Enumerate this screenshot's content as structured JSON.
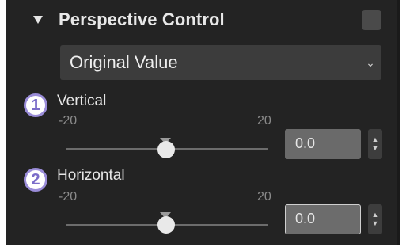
{
  "section": {
    "title": "Perspective Control",
    "dropdown_value": "Original Value"
  },
  "sliders": [
    {
      "badge": "1",
      "label": "Vertical",
      "min_label": "-20",
      "max_label": "20",
      "value": "0.0",
      "level": 0.5
    },
    {
      "badge": "2",
      "label": "Horizontal",
      "min_label": "-20",
      "max_label": "20",
      "value": "0.0",
      "level": 0.5
    }
  ],
  "icons": {
    "collapse": "triangle-down-icon",
    "dropdown": "chevron-down-icon",
    "spinner": "up-down-arrows-icon"
  }
}
